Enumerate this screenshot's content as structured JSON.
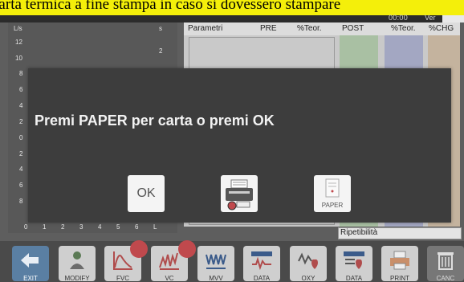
{
  "banner": {
    "text": "carta termica a fine stampa in caso si dovessero stampare"
  },
  "statusbar": {
    "time": "00:00",
    "version_label": "Ver"
  },
  "left_panel": {
    "top_left": "L/s",
    "top_right": "s",
    "y_labels": [
      "12",
      "10",
      "8",
      "6",
      "4",
      "2",
      "0",
      "2",
      "4",
      "6",
      "8"
    ],
    "right_label": "2",
    "x_labels": [
      "0",
      "1",
      "2",
      "3",
      "4",
      "5",
      "6",
      "L"
    ]
  },
  "table": {
    "headers": [
      "Parametri",
      "PRE",
      "%Teor.",
      "POST",
      "%Teor.",
      "%CHG"
    ],
    "ripetibilita": "Ripetibilità"
  },
  "toolbar": {
    "buttons": [
      {
        "label": "EXIT",
        "icon": "exit-arrow-icon"
      },
      {
        "label": "MODIFY",
        "icon": "patient-icon"
      },
      {
        "label": "FVC",
        "icon": "fvc-curve-icon"
      },
      {
        "label": "VC",
        "icon": "vc-curve-icon"
      },
      {
        "label": "MVV",
        "icon": "mvv-wave-icon"
      },
      {
        "label": "DATA",
        "icon": "data-ecg-icon"
      },
      {
        "label": "OXY",
        "icon": "oxy-heart-icon"
      },
      {
        "label": "DATA",
        "icon": "data-heart-icon"
      },
      {
        "label": "PRINT",
        "icon": "printer-icon"
      },
      {
        "label": "CANC",
        "icon": "trash-icon"
      }
    ]
  },
  "dialog": {
    "message": "Premi PAPER per carta o premi OK",
    "ok_label": "OK",
    "paper_label": "PAPER"
  }
}
